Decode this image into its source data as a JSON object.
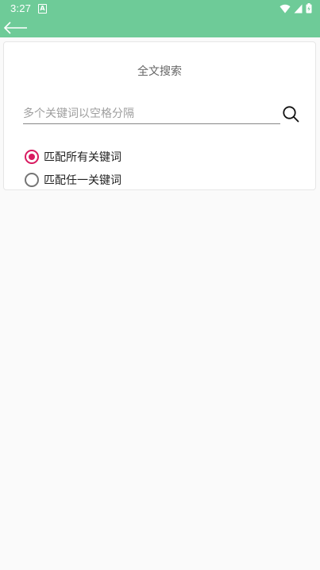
{
  "status_bar": {
    "time": "3:27",
    "notification_icon": "a-icon",
    "icons": [
      "wifi-icon",
      "signal-icon",
      "battery-icon"
    ]
  },
  "toolbar": {
    "back_icon": "arrow-left-icon"
  },
  "search": {
    "title": "全文搜索",
    "placeholder": "多个关键词以空格分隔",
    "value": "",
    "search_icon": "magnifier-icon"
  },
  "match_options": [
    {
      "label": "匹配所有关键词",
      "checked": true
    },
    {
      "label": "匹配任一关键词",
      "checked": false
    }
  ],
  "colors": {
    "accent": "#6ecb98",
    "radio_checked": "#d81b60",
    "background": "#fafafa"
  }
}
